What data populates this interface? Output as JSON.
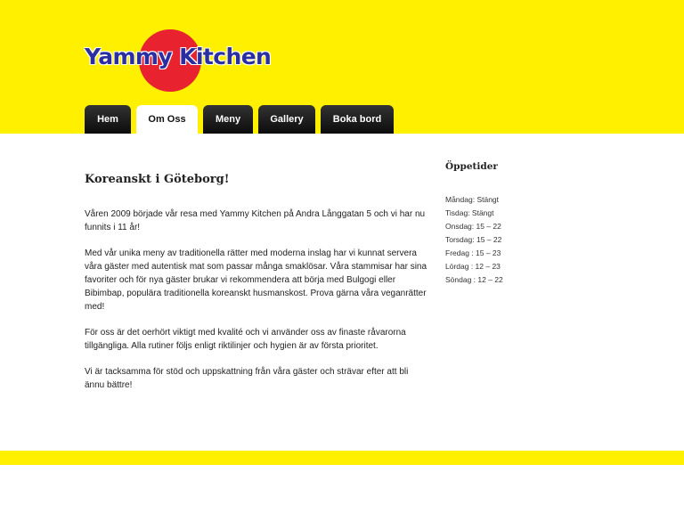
{
  "brand": {
    "name": "Yammy Kitchen",
    "colors": {
      "primary_yellow": "#fff000",
      "logo_red": "#e8232f",
      "logo_blue": "#2b2ea0",
      "nav_dark": "#111111"
    }
  },
  "nav": {
    "active": "Om Oss",
    "items": [
      {
        "label": "Hem"
      },
      {
        "label": "Om Oss"
      },
      {
        "label": "Meny"
      },
      {
        "label": "Gallery"
      },
      {
        "label": "Boka bord"
      }
    ]
  },
  "main": {
    "title": "Koreanskt i Göteborg!",
    "paragraphs": [
      "Våren 2009 började vår resa med Yammy Kitchen på Andra Långgatan 5 och vi har nu funnits i 11 år!",
      "Med vår unika meny av traditionella rätter med moderna inslag har vi kunnat servera våra gäster med autentisk mat som passar många smaklösar. Våra stammisar har sina favoriter och för nya gäster brukar vi rekommendera att börja med Bulgogi eller Bibimbap, populära traditionella koreanskt husmanskost. Prova gärna våra veganrätter med!",
      "För oss är det oerhört viktigt med kvalité och vi använder oss av finaste råvarorna tillgängliga. Alla rutiner följs enligt riktilinjer och hygien är av första prioritet.",
      "Vi är tacksamma för stöd och uppskattning från våra gäster och strävar efter att bli ännu bättre!"
    ]
  },
  "sidebar": {
    "title": "Öppetider",
    "hours": [
      "Måndag: Stängt",
      "Tisdag: Stängt",
      "Onsdag: 15 – 22",
      "Torsdag: 15 – 22",
      "Fredag : 15 – 23",
      "Lördag : 12 – 23",
      "Söndag : 12 – 22"
    ]
  }
}
